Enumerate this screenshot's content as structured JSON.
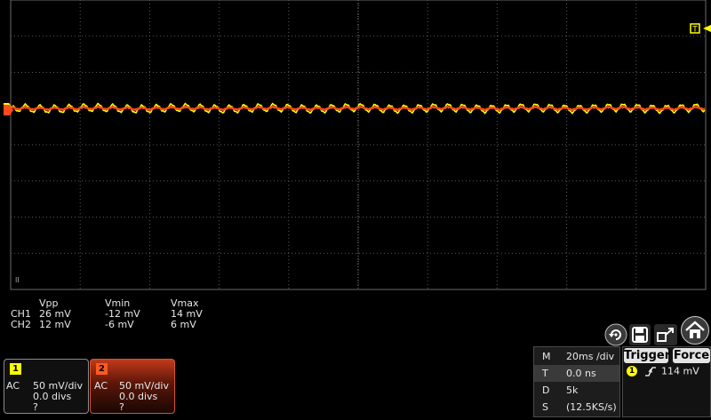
{
  "colors": {
    "ch1": "#ffff00",
    "ch2": "#ff4a1c",
    "grid": "#5a5a5a",
    "background": "#000000"
  },
  "measurements": {
    "headers": [
      "Vpp",
      "Vmin",
      "Vmax"
    ],
    "rows": [
      {
        "label": "CH1",
        "vpp": "26 mV",
        "vmin": "-12 mV",
        "vmax": "14 mV"
      },
      {
        "label": "CH2",
        "vpp": "12 mV",
        "vmin": "-6 mV",
        "vmax": "6 mV"
      }
    ]
  },
  "channels": [
    {
      "number": "1",
      "coupling": "AC",
      "scale": "50 mV/div",
      "offset": "0.0 divs",
      "probe": "?"
    },
    {
      "number": "2",
      "coupling": "AC",
      "scale": "50 mV/div",
      "offset": "0.0 divs",
      "probe": "?"
    }
  ],
  "timebase": {
    "rows": [
      {
        "key": "M",
        "value": "20ms /div"
      },
      {
        "key": "T",
        "value": "0.0 ns"
      },
      {
        "key": "D",
        "value": "5k"
      },
      {
        "key": "S",
        "value": "(12.5KS/s)"
      }
    ]
  },
  "trigger": {
    "trigger_label": "Trigger",
    "force_label": "Force",
    "source": "1",
    "level": "114 mV"
  },
  "markers": {
    "trigger_position": "T",
    "ground_level_ch1": "1",
    "ground_level_ch2": "2",
    "roll_marker": "II"
  },
  "icons": [
    "recall-icon",
    "save-icon",
    "export-icon",
    "home-icon"
  ]
}
